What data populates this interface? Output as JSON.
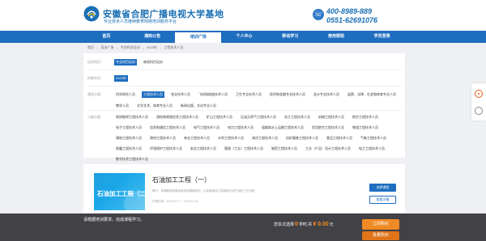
{
  "header": {
    "title": "安徽省合肥广播电视大学基地",
    "subtitle": "专业技术人员继续教育网络培训服务平台",
    "phone1": "400-8989-889",
    "phone2": "0551-62691076",
    "phone_icon": "phone-icon"
  },
  "nav": {
    "items": [
      "首页",
      "通知公告",
      "培训广场",
      "个人中心",
      "移动学习",
      "使用帮助",
      "学员登录"
    ],
    "active_index": 2
  },
  "breadcrumb": [
    "首页",
    "培训广场",
    "专业科目培训",
    "2023年",
    "工程技术人员"
  ],
  "filter": {
    "training_label": "培训科目：",
    "training_items": [
      "专业科目培训",
      "继续科目培训"
    ],
    "year_label": "所属年份：",
    "year_items": [
      "2023年"
    ],
    "category_label": "课程分类：",
    "category_items": [
      "科学研究人员",
      "工程技术人员",
      "农业技术人员",
      "飞机和船舶技术人员",
      "卫生专业技术人员",
      "经济和金融专业技术人员",
      "会计专业技术人员",
      "监察、法律、社会和体育专业人员",
      "教学人员",
      "文学艺术、体育专业人员",
      "新闻出版、文化专业人员"
    ],
    "subcategory_label": "二级分类：",
    "subcategory_items": [
      "地质勘探工程技术人员",
      "测绘和地理信息工程技术人员",
      "矿山工程技术人员",
      "石油天然气工程技术人员",
      "化工工程技术人员",
      "机械工程技术人员",
      "航空工程技术人员",
      "电子工程技术人员",
      "信息和通信工程技术人员",
      "电气工程技术人员",
      "电力工程技术人员",
      "道路和水上运输工程技术人员",
      "民用航空工程技术人员",
      "铁道工程技术人员",
      "建筑工程技术人员",
      "建材工程技术人员",
      "林业工程技术人员",
      "水利工程技术人员",
      "海洋工程技术人员",
      "纺织服装工程技术人员",
      "食品工程技术人员",
      "气象工程技术人员",
      "地震工程技术人员",
      "环境保护工程技术人员",
      "安全工程技术人员",
      "管理（工业）工程技术人员",
      "制药工程技术人员",
      "工业（产品）设计工程技术人员",
      "轻工工程技术人员",
      "数字技术工程技术人员"
    ],
    "selected_training": "专业科目培训",
    "selected_year": "2023年",
    "selected_category": "工程技术人员"
  },
  "course": {
    "title": "石油加工工程（一）",
    "thumb_text": "石油加工工程（二）",
    "intro": "简介：本课程讲授原油组成及基础知识，以及原油加工成各种石油产品的工艺过程...",
    "date": "开课日期：2023.04.17 ~ 2023.12.31",
    "choose_label": "选择课程",
    "detail_label": "查看详情"
  },
  "bottom": {
    "hint": "请根据培训要求，完成课程学习。",
    "summary_prefix": "您本次选择",
    "hours": "0",
    "hours_unit": "学时,共",
    "price": "¥ 0.00",
    "price_unit": "元",
    "buy_label": "立即购买",
    "cart_label": "批量购买"
  },
  "colors": {
    "primary": "#1e6ec0",
    "accent": "#f08a24",
    "float_icon": "#e85a1c"
  }
}
